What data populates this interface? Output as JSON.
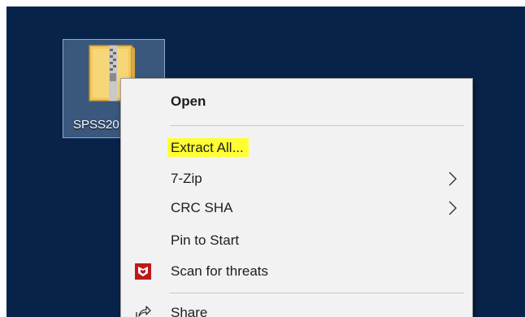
{
  "desktop": {
    "icon": {
      "label": "SPSS20",
      "icon_name": "zip-folder-icon"
    }
  },
  "context_menu": {
    "items": [
      {
        "label": "Open",
        "bold": true
      },
      {
        "label": "Extract All...",
        "highlighted": true
      },
      {
        "label": "7-Zip",
        "submenu": true
      },
      {
        "label": "CRC SHA",
        "submenu": true
      },
      {
        "label": "Pin to Start"
      },
      {
        "label": "Scan for threats",
        "icon_name": "mcafee-shield-icon"
      },
      {
        "label": "Share",
        "icon_name": "share-icon"
      }
    ]
  },
  "colors": {
    "desktop_bg": "#08234a",
    "menu_bg": "#f2f2f2",
    "highlight": "#ffff33",
    "mcafee_red": "#c01818"
  }
}
